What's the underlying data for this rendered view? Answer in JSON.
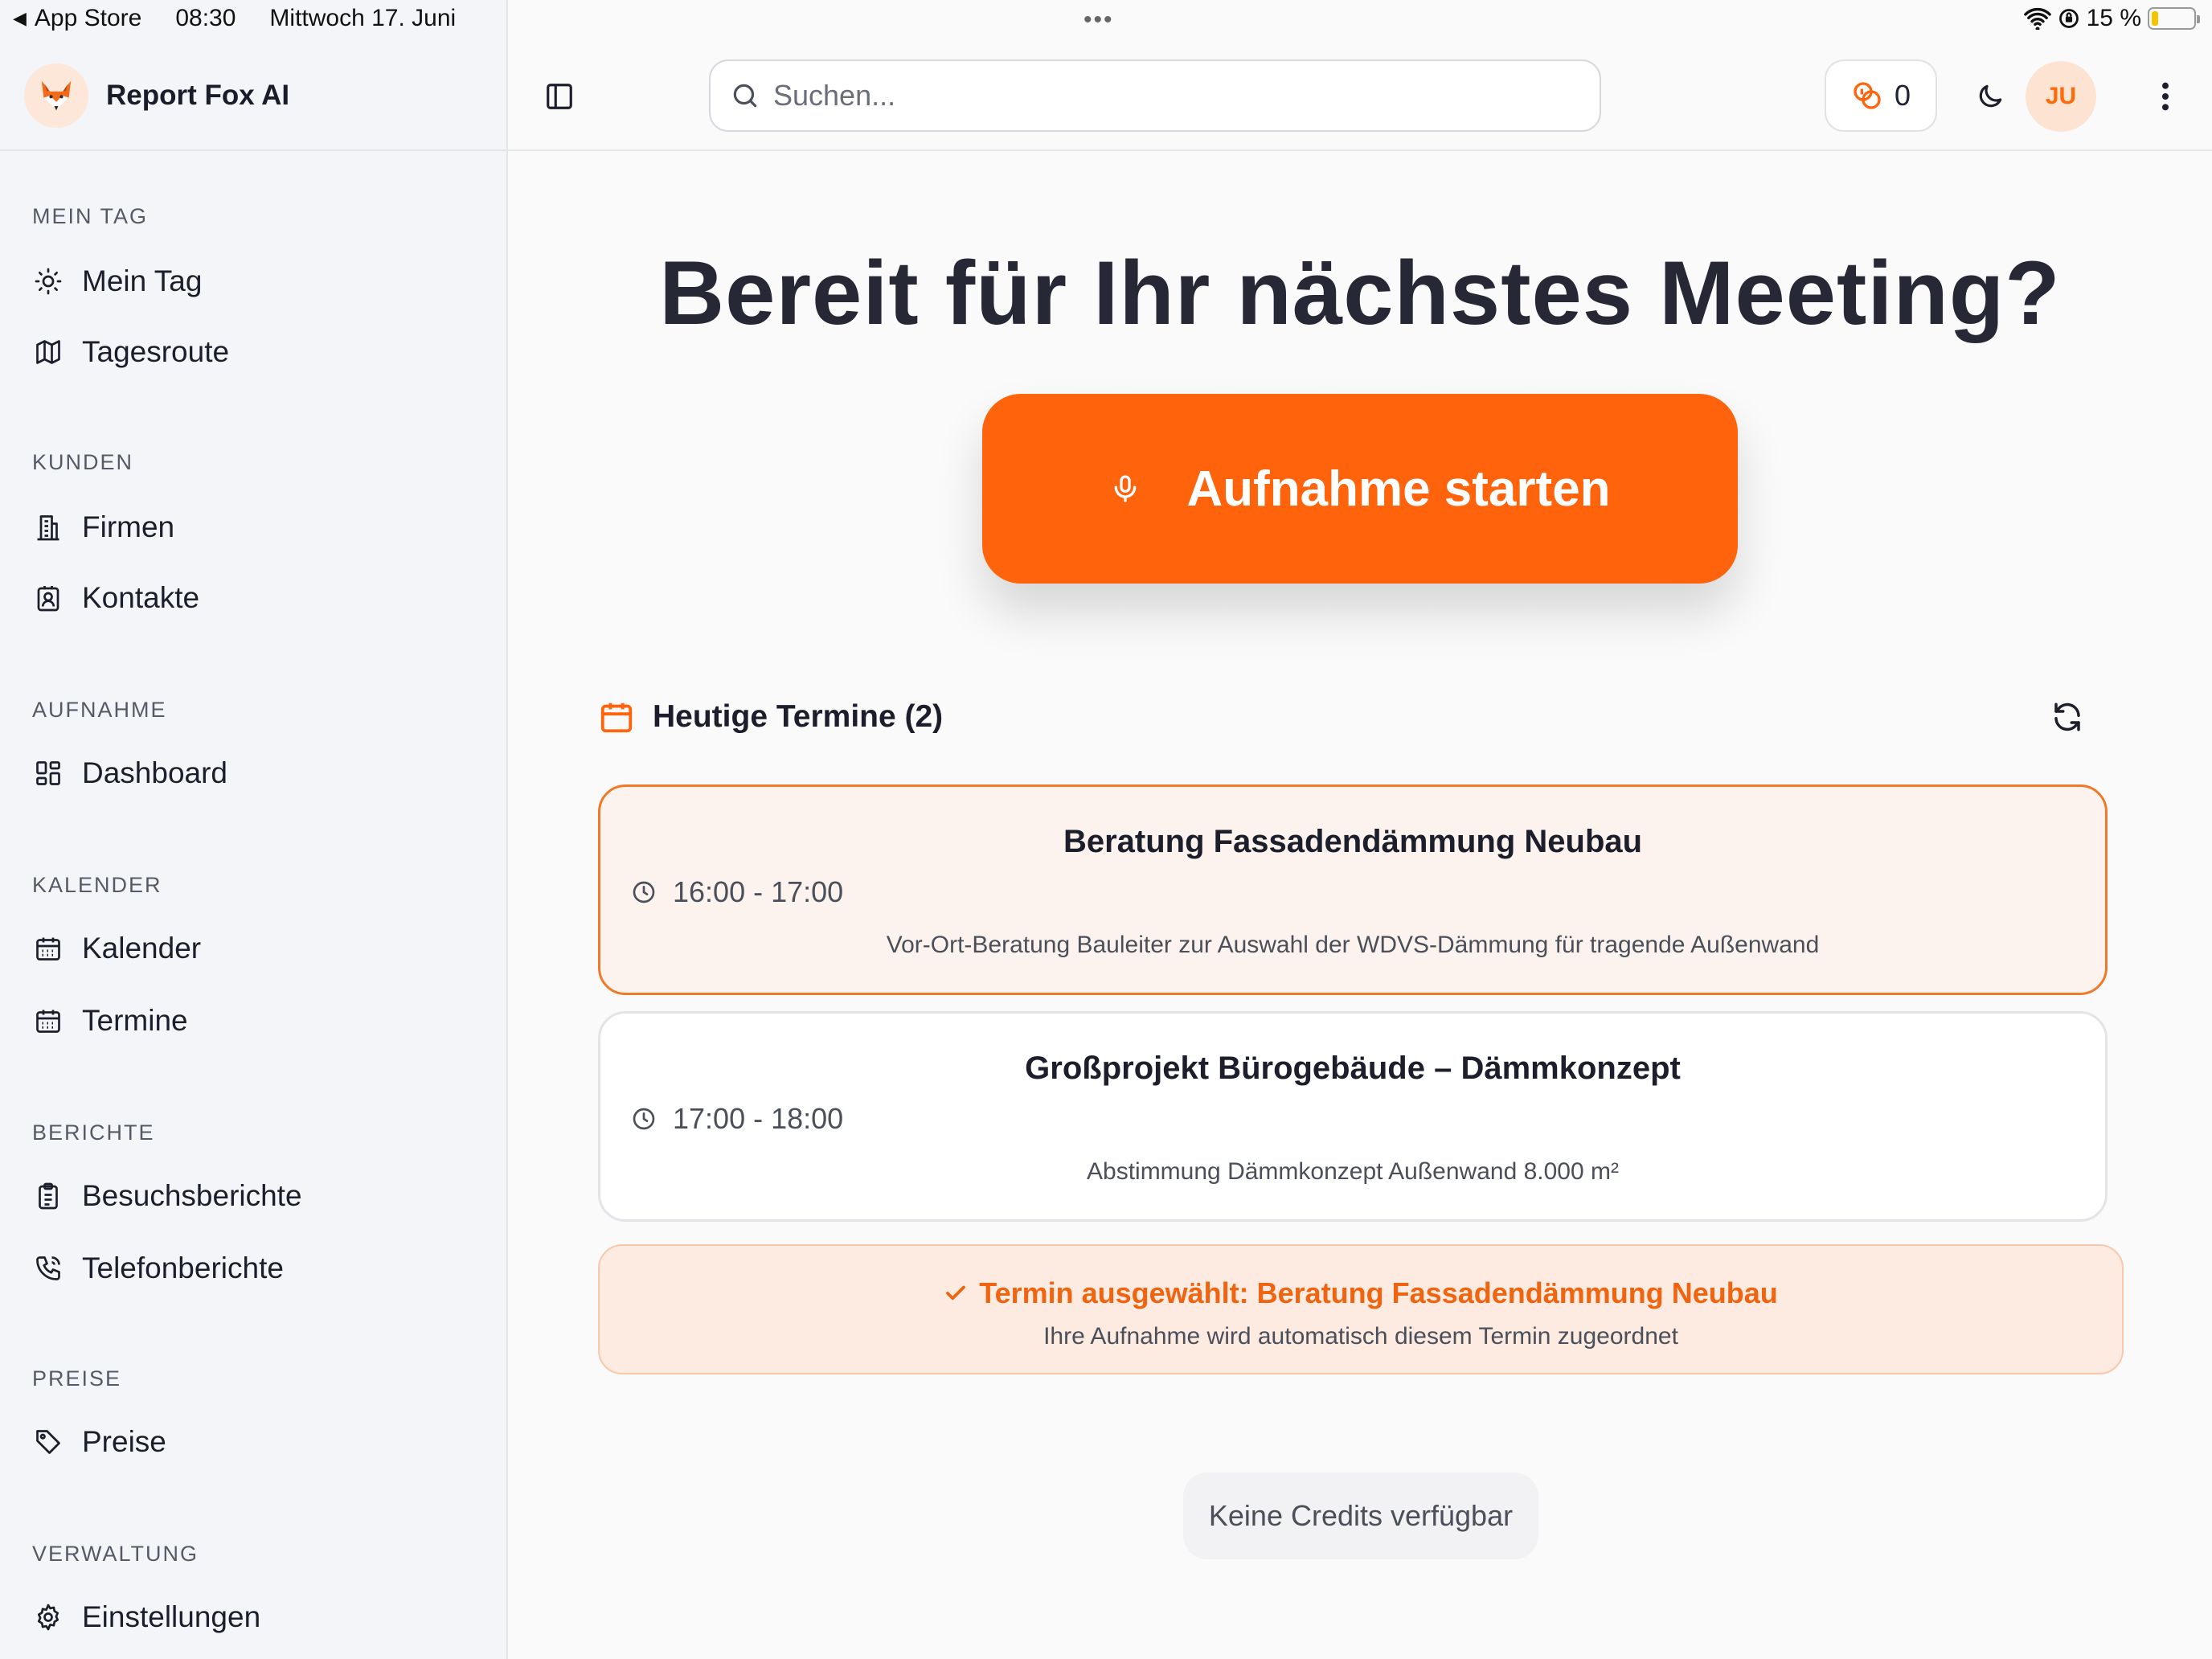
{
  "status_bar": {
    "back_app": "App Store",
    "time": "08:30",
    "date": "Mittwoch 17. Juni",
    "battery_text": "15 %",
    "battery_level": 0.15,
    "battery_color": "#f5c400"
  },
  "brand": {
    "name": "Report Fox AI",
    "logo_icon": "fox-icon"
  },
  "sidebar": {
    "sections": [
      {
        "heading": "MEIN TAG",
        "items": [
          {
            "label": "Mein Tag",
            "icon": "sun-icon"
          },
          {
            "label": "Tagesroute",
            "icon": "map-icon"
          }
        ]
      },
      {
        "heading": "KUNDEN",
        "items": [
          {
            "label": "Firmen",
            "icon": "building-icon"
          },
          {
            "label": "Kontakte",
            "icon": "contact-icon"
          }
        ]
      },
      {
        "heading": "AUFNAHME",
        "items": [
          {
            "label": "Dashboard",
            "icon": "dashboard-icon"
          }
        ]
      },
      {
        "heading": "KALENDER",
        "items": [
          {
            "label": "Kalender",
            "icon": "calendar-icon"
          },
          {
            "label": "Termine",
            "icon": "calendar-icon"
          }
        ]
      },
      {
        "heading": "BERICHTE",
        "items": [
          {
            "label": "Besuchsberichte",
            "icon": "clipboard-icon"
          },
          {
            "label": "Telefonberichte",
            "icon": "phone-icon"
          }
        ]
      },
      {
        "heading": "PREISE",
        "items": [
          {
            "label": "Preise",
            "icon": "tag-icon"
          }
        ]
      },
      {
        "heading": "VERWALTUNG",
        "items": [
          {
            "label": "Einstellungen",
            "icon": "gear-icon"
          }
        ]
      }
    ]
  },
  "topbar": {
    "search_placeholder": "Suchen...",
    "credits_count": "0",
    "avatar_initials": "JU"
  },
  "main": {
    "hero_title": "Bereit für Ihr nächstes Meeting?",
    "record_button_label": "Aufnahme starten",
    "appointments_title": "Heutige Termine (2)",
    "appointments": [
      {
        "title": "Beratung Fassadendämmung Neubau",
        "time": "16:00 - 17:00",
        "description": "Vor-Ort-Beratung Bauleiter zur Auswahl der WDVS-Dämmung für tragende Außenwand",
        "selected": true
      },
      {
        "title": "Großprojekt Bürogebäude – Dämmkonzept",
        "time": "17:00 - 18:00",
        "description": "Abstimmung Dämmkonzept Außenwand 8.000 m²",
        "selected": false
      }
    ],
    "selection_banner": {
      "title": "Termin ausgewählt: Beratung Fassadendämmung Neubau",
      "subtitle": "Ihre Aufnahme wird automatisch diesem Termin zugeordnet"
    },
    "no_credits_label": "Keine Credits verfügbar"
  },
  "colors": {
    "accent": "#ff630b",
    "accent_text": "#f06410",
    "selected_bg": "#fdf3ee",
    "selected_border": "#f07a2a",
    "banner_bg": "#fdeae0"
  }
}
